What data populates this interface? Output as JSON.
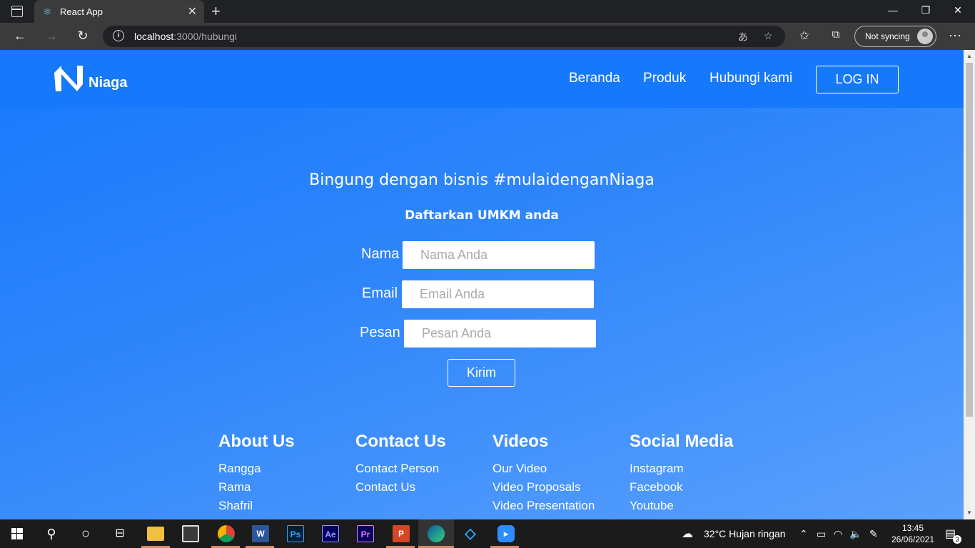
{
  "browser": {
    "tab_title": "React App",
    "url_host": "localhost",
    "url_path": ":3000/hubungi",
    "sync_label": "Not syncing"
  },
  "navbar": {
    "brand": "Niaga",
    "links": [
      "Beranda",
      "Produk",
      "Hubungi kami"
    ],
    "login": "LOG IN"
  },
  "hero": {
    "headline": "Bingung dengan bisnis #mulaidenganNiaga",
    "subheadline": "Daftarkan UMKM anda"
  },
  "form": {
    "nama_label": "Nama",
    "nama_placeholder": "Nama Anda",
    "email_label": "Email",
    "email_placeholder": "Email Anda",
    "pesan_label": "Pesan",
    "pesan_placeholder": "Pesan Anda",
    "submit": "Kirim"
  },
  "footer": {
    "columns": [
      {
        "title": "About Us",
        "items": [
          "Rangga",
          "Rama",
          "Shafril"
        ]
      },
      {
        "title": "Contact Us",
        "items": [
          "Contact Person",
          "Contact Us"
        ]
      },
      {
        "title": "Videos",
        "items": [
          "Our Video",
          "Video Proposals",
          "Video Presentation"
        ]
      },
      {
        "title": "Social Media",
        "items": [
          "Instagram",
          "Facebook",
          "Youtube"
        ]
      }
    ]
  },
  "taskbar": {
    "weather": "32°C  Hujan ringan",
    "time": "13:45",
    "date": "26/06/2021",
    "notifications": "3"
  }
}
